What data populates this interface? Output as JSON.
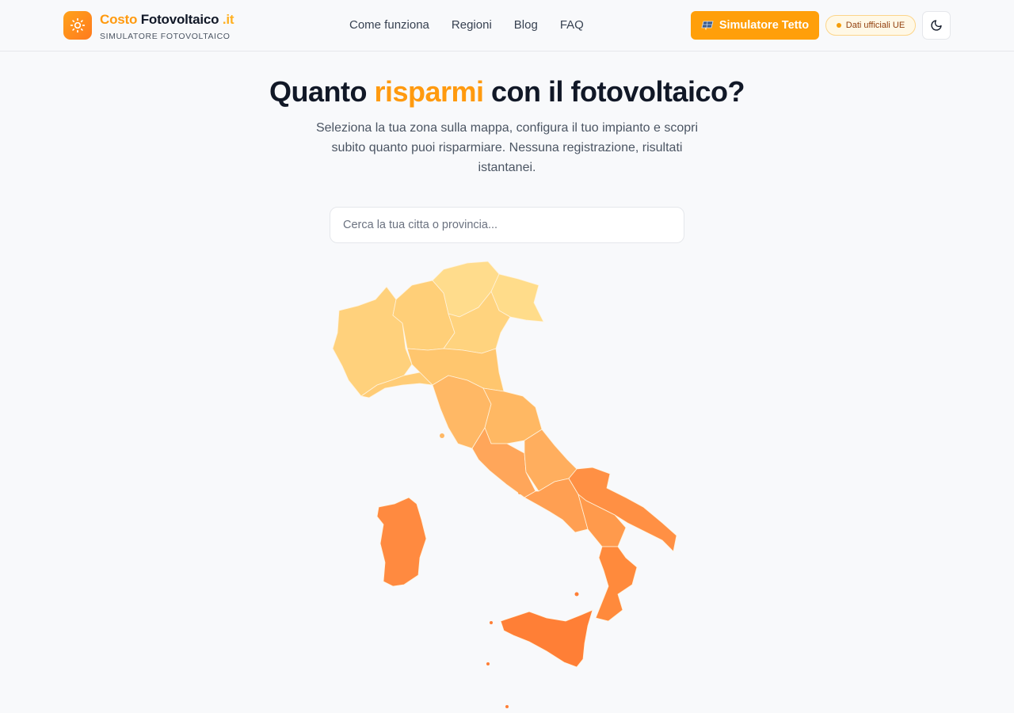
{
  "brand": {
    "part1": "Costo",
    "part2": "Fotovoltaico",
    "part3": ".it",
    "subtitle": "SIMULATORE FOTOVOLTAICO"
  },
  "nav": [
    {
      "label": "Come funziona"
    },
    {
      "label": "Regioni"
    },
    {
      "label": "Blog"
    },
    {
      "label": "FAQ"
    }
  ],
  "header": {
    "cta_label": "Simulatore Tetto",
    "badge_label": "Dati ufficiali UE",
    "theme_icon": "moon-icon"
  },
  "hero": {
    "title_pre": "Quanto ",
    "title_highlight": "risparmi",
    "title_post": " con il fotovoltaico?",
    "description": "Seleziona la tua zona sulla mappa, configura il tuo impianto e scopri subito quanto puoi risparmiare. Nessuna registrazione, risultati istantanei."
  },
  "search": {
    "placeholder": "Cerca la tua citta o provincia...",
    "value": ""
  },
  "colors": {
    "accent": "#ff9f0a",
    "map_north": "#ffd27a",
    "map_center": "#ffb561",
    "map_south": "#ff8a3d",
    "map_islands": "#ff8040"
  }
}
